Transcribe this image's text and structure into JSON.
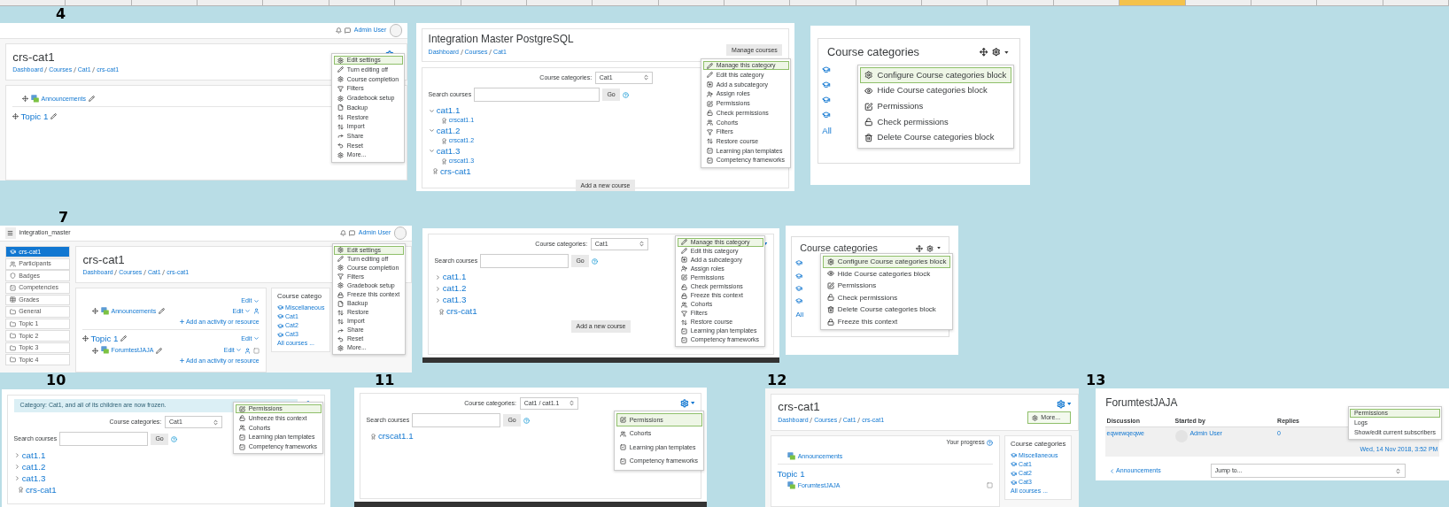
{
  "sheet": {
    "column_headers": [
      {
        "selected": false
      },
      {
        "selected": false
      },
      {
        "selected": false
      },
      {
        "selected": false
      },
      {
        "selected": false
      },
      {
        "selected": false
      },
      {
        "selected": false
      },
      {
        "selected": false
      },
      {
        "selected": false
      },
      {
        "selected": false
      },
      {
        "selected": false
      },
      {
        "selected": false
      },
      {
        "selected": false
      },
      {
        "selected": false
      },
      {
        "selected": false
      },
      {
        "selected": false
      },
      {
        "selected": false
      },
      {
        "selected": true
      },
      {
        "selected": false
      },
      {
        "selected": false
      },
      {
        "selected": false
      },
      {
        "selected": false
      }
    ]
  },
  "figures": [
    {
      "caption": "4",
      "kind": "course",
      "navbar": {
        "user": "Admin User"
      },
      "title": "crs-cat1",
      "breadcrumb": [
        "Dashboard",
        "Courses",
        "Cat1",
        "crs-cat1"
      ],
      "editing": true,
      "sections": [
        {
          "activities": [
            {
              "name": "Announcements"
            }
          ]
        },
        {
          "title": "Topic 1"
        }
      ],
      "menu": [
        {
          "label": "Edit settings",
          "kind": "settings",
          "selected": true
        },
        {
          "label": "Turn editing off",
          "kind": "edit",
          "selected": false
        },
        {
          "label": "Course completion",
          "kind": "settings",
          "selected": false
        },
        {
          "label": "Filters",
          "kind": "filter",
          "selected": false
        },
        {
          "label": "Gradebook setup",
          "kind": "settings",
          "selected": false
        },
        {
          "label": "Backup",
          "kind": "backup",
          "selected": false
        },
        {
          "label": "Restore",
          "kind": "restore",
          "selected": false
        },
        {
          "label": "Import",
          "kind": "restore",
          "selected": false
        },
        {
          "label": "Share",
          "kind": "share",
          "selected": false
        },
        {
          "label": "Reset",
          "kind": "reset",
          "selected": false
        },
        {
          "label": "More...",
          "kind": "settings",
          "selected": false
        }
      ]
    },
    {
      "kind": "category",
      "header": {
        "title": "Integration Master PostgreSQL",
        "breadcrumb": [
          "Dashboard",
          "Courses",
          "Cat1"
        ],
        "button": "Manage courses"
      },
      "select_label": "Course categories:",
      "select_value": "Cat1",
      "search_label": "Search courses",
      "search_button": "Go",
      "categories": [
        {
          "name": "cat1.1",
          "expanded": true,
          "courses": [
            "crscat1.1"
          ]
        },
        {
          "name": "cat1.2",
          "expanded": true,
          "courses": [
            "crscat1.2"
          ]
        },
        {
          "name": "cat1.3",
          "expanded": true,
          "courses": [
            "crscat1.3"
          ]
        }
      ],
      "courses": [
        "crs-cat1"
      ],
      "add_button": "Add a new course",
      "menu": [
        {
          "label": "Manage this category",
          "kind": "edit",
          "selected": true
        },
        {
          "label": "Edit this category",
          "kind": "edit",
          "selected": false
        },
        {
          "label": "Add a subcategory",
          "kind": "add",
          "selected": false
        },
        {
          "label": "Assign roles",
          "kind": "roles",
          "selected": false
        },
        {
          "label": "Permissions",
          "kind": "permissions",
          "selected": false
        },
        {
          "label": "Check permissions",
          "kind": "check",
          "selected": false
        },
        {
          "label": "Cohorts",
          "kind": "cohorts",
          "selected": false
        },
        {
          "label": "Filters",
          "kind": "filter",
          "selected": false
        },
        {
          "label": "Restore course",
          "kind": "restore",
          "selected": false
        },
        {
          "label": "Learning plan templates",
          "kind": "templates",
          "selected": false
        },
        {
          "label": "Competency frameworks",
          "kind": "templates",
          "selected": false
        }
      ]
    },
    {
      "kind": "block_menu",
      "block_title": "Course categories",
      "all_link": "All",
      "menu": [
        {
          "label": "Configure Course categories block",
          "kind": "settings",
          "selected": true
        },
        {
          "label": "Hide Course categories block",
          "kind": "hide",
          "selected": false
        },
        {
          "label": "Permissions",
          "kind": "permissions",
          "selected": false
        },
        {
          "label": "Check permissions",
          "kind": "check",
          "selected": false
        },
        {
          "label": "Delete Course categories block",
          "kind": "delete",
          "selected": false
        }
      ]
    },
    {
      "caption": "7",
      "kind": "course",
      "navbar": {
        "site": "integration_master",
        "user": "Admin User"
      },
      "nav": [
        {
          "label": "crs-cat1",
          "kind": "course",
          "selected": true
        },
        {
          "label": "Participants",
          "kind": "users",
          "selected": false
        },
        {
          "label": "Badges",
          "kind": "badge",
          "selected": false
        },
        {
          "label": "Competencies",
          "kind": "check",
          "selected": false
        },
        {
          "label": "Grades",
          "kind": "grid",
          "selected": false
        },
        {
          "label": "General",
          "kind": "folder",
          "selected": false
        },
        {
          "label": "Topic 1",
          "kind": "folder",
          "selected": false
        },
        {
          "label": "Topic 2",
          "kind": "folder",
          "selected": false
        },
        {
          "label": "Topic 3",
          "kind": "folder",
          "selected": false
        },
        {
          "label": "Topic 4",
          "kind": "folder",
          "selected": false
        }
      ],
      "title": "crs-cat1",
      "breadcrumb": [
        "Dashboard",
        "Courses",
        "Cat1",
        "crs-cat1"
      ],
      "editing": true,
      "sections": [
        {
          "edit": "Edit",
          "activities": [
            {
              "name": "Announcements",
              "edit": "Edit"
            }
          ],
          "add": "Add an activity or resource"
        },
        {
          "title": "Topic 1",
          "edit": "Edit",
          "activities": [
            {
              "name": "ForumtestJAJA",
              "edit": "Edit",
              "completion": false
            }
          ],
          "add": "Add an activity or resource"
        }
      ],
      "block": {
        "title": "Course catego",
        "links": [
          "Miscellaneous",
          "Cat1",
          "Cat2",
          "Cat3"
        ],
        "all": "All courses ..."
      },
      "menu": [
        {
          "label": "Edit settings",
          "kind": "settings",
          "selected": true
        },
        {
          "label": "Turn editing off",
          "kind": "edit",
          "selected": false
        },
        {
          "label": "Course completion",
          "kind": "settings",
          "selected": false
        },
        {
          "label": "Filters",
          "kind": "filter",
          "selected": false
        },
        {
          "label": "Gradebook setup",
          "kind": "settings",
          "selected": false
        },
        {
          "label": "Freeze this context",
          "kind": "lock",
          "selected": false
        },
        {
          "label": "Backup",
          "kind": "backup",
          "selected": false
        },
        {
          "label": "Restore",
          "kind": "restore",
          "selected": false
        },
        {
          "label": "Import",
          "kind": "restore",
          "selected": false
        },
        {
          "label": "Share",
          "kind": "share",
          "selected": false
        },
        {
          "label": "Reset",
          "kind": "reset",
          "selected": false
        },
        {
          "label": "More...",
          "kind": "settings",
          "selected": false
        }
      ]
    },
    {
      "kind": "category",
      "select_label": "Course categories:",
      "select_value": "Cat1",
      "search_label": "Search courses",
      "search_button": "Go",
      "categories": [
        {
          "name": "cat1.1",
          "expanded": false
        },
        {
          "name": "cat1.2",
          "expanded": false
        },
        {
          "name": "cat1.3",
          "expanded": false
        }
      ],
      "courses": [
        "crs-cat1"
      ],
      "add_button": "Add a new course",
      "footer_bar": true,
      "menu": [
        {
          "label": "Manage this category",
          "kind": "edit",
          "selected": true
        },
        {
          "label": "Edit this category",
          "kind": "edit",
          "selected": false
        },
        {
          "label": "Add a subcategory",
          "kind": "add",
          "selected": false
        },
        {
          "label": "Assign roles",
          "kind": "roles",
          "selected": false
        },
        {
          "label": "Permissions",
          "kind": "permissions",
          "selected": false
        },
        {
          "label": "Check permissions",
          "kind": "check",
          "selected": false
        },
        {
          "label": "Freeze this context",
          "kind": "lock",
          "selected": false
        },
        {
          "label": "Cohorts",
          "kind": "cohorts",
          "selected": false
        },
        {
          "label": "Filters",
          "kind": "filter",
          "selected": false
        },
        {
          "label": "Restore course",
          "kind": "restore",
          "selected": false
        },
        {
          "label": "Learning plan templates",
          "kind": "templates",
          "selected": false
        },
        {
          "label": "Competency frameworks",
          "kind": "templates",
          "selected": false
        }
      ]
    },
    {
      "kind": "block_menu",
      "block_title": "Course categories",
      "all_link": "All",
      "menu": [
        {
          "label": "Configure Course categories block",
          "kind": "settings",
          "selected": true
        },
        {
          "label": "Hide Course categories block",
          "kind": "hide",
          "selected": false
        },
        {
          "label": "Permissions",
          "kind": "permissions",
          "selected": false
        },
        {
          "label": "Check permissions",
          "kind": "check",
          "selected": false
        },
        {
          "label": "Delete Course categories block",
          "kind": "delete",
          "selected": false
        },
        {
          "label": "Freeze this context",
          "kind": "lock",
          "selected": false
        }
      ]
    },
    {
      "caption": "10",
      "kind": "category",
      "alert": "Category: Cat1, and all of its children are now frozen.",
      "select_label": "Course categories:",
      "select_value": "Cat1",
      "search_label": "Search courses",
      "search_button": "Go",
      "categories": [
        {
          "name": "cat1.1",
          "expanded": false
        },
        {
          "name": "cat1.2",
          "expanded": false
        },
        {
          "name": "cat1.3",
          "expanded": false
        }
      ],
      "courses": [
        "crs-cat1"
      ],
      "menu": [
        {
          "label": "Permissions",
          "kind": "permissions",
          "selected": true
        },
        {
          "label": "Unfreeze this context",
          "kind": "unlock",
          "selected": false
        },
        {
          "label": "Cohorts",
          "kind": "cohorts",
          "selected": false
        },
        {
          "label": "Learning plan templates",
          "kind": "templates",
          "selected": false
        },
        {
          "label": "Competency frameworks",
          "kind": "templates",
          "selected": false
        }
      ]
    },
    {
      "caption": "11",
      "kind": "category",
      "select_label": "Course categories:",
      "select_value": "Cat1 / cat1.1",
      "search_label": "Search courses",
      "search_button": "Go",
      "courses": [
        "crscat1.1"
      ],
      "footer_bar": true,
      "menu": [
        {
          "label": "Permissions",
          "kind": "permissions",
          "selected": true
        },
        {
          "label": "Cohorts",
          "kind": "cohorts",
          "selected": false
        },
        {
          "label": "Learning plan templates",
          "kind": "templates",
          "selected": false
        },
        {
          "label": "Competency frameworks",
          "kind": "templates",
          "selected": false
        }
      ]
    },
    {
      "caption": "12",
      "kind": "course",
      "title": "crs-cat1",
      "breadcrumb": [
        "Dashboard",
        "Courses",
        "Cat1",
        "crs-cat1"
      ],
      "header_button": {
        "label": "More...",
        "focused": true
      },
      "editing": false,
      "progress": "Your progress",
      "sections": [
        {
          "activities": [
            {
              "name": "Announcements"
            }
          ]
        },
        {
          "title": "Topic 1",
          "activities": [
            {
              "name": "ForumtestJAJA",
              "completion": false
            }
          ]
        }
      ],
      "block": {
        "title": "Course categories",
        "links": [
          "Miscellaneous",
          "Cat1",
          "Cat2",
          "Cat3"
        ],
        "all": "All courses ..."
      }
    },
    {
      "caption": "13",
      "kind": "forum",
      "title": "ForumtestJAJA",
      "table": {
        "columns": [
          "Discussion",
          "Started by",
          "Replies"
        ],
        "rows": [
          {
            "cells": [
              "eqwewqeqwe",
              "Admin User",
              "0",
              "Wed, 14 Nov 2018, 3:52 PM"
            ]
          }
        ]
      },
      "back_link": "Announcements",
      "jump_select": "Jump to...",
      "menu": [
        {
          "label": "Permissions",
          "kind": "plain",
          "selected": true
        },
        {
          "label": "Logs",
          "kind": "plain",
          "selected": false
        },
        {
          "label": "Show/edit current subscribers",
          "kind": "plain",
          "selected": false
        }
      ]
    }
  ]
}
